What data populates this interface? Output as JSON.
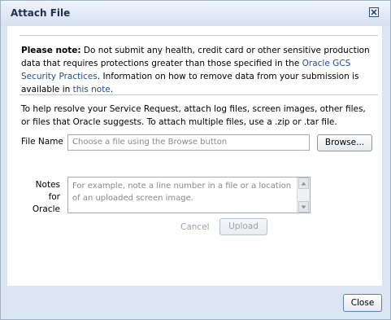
{
  "dialog": {
    "title": "Attach File",
    "close_icon": "close-x-icon"
  },
  "notice": {
    "bold_lead": "Please note:",
    "text_1": " Do not submit any health, credit card or other sensitive production data that requires protections greater than those specified in the ",
    "link_1": "Oracle GCS Security Practices",
    "text_2": ". Information on how to remove data from your submission is available in ",
    "link_2": "this note",
    "text_3": "."
  },
  "help_text": "To help resolve your Service Request, attach log files, screen images, other files, or files that Oracle suggests. To attach multiple files, use a .zip or .tar file.",
  "file": {
    "label": "File Name",
    "placeholder": "Choose a file using the Browse button",
    "browse_label": "Browse..."
  },
  "notes": {
    "label": "Notes for Oracle",
    "placeholder": "For example, note a line number in a file or a location of an uploaded screen image."
  },
  "actions": {
    "cancel_label": "Cancel",
    "upload_label": "Upload"
  },
  "footer": {
    "close_label": "Close"
  }
}
